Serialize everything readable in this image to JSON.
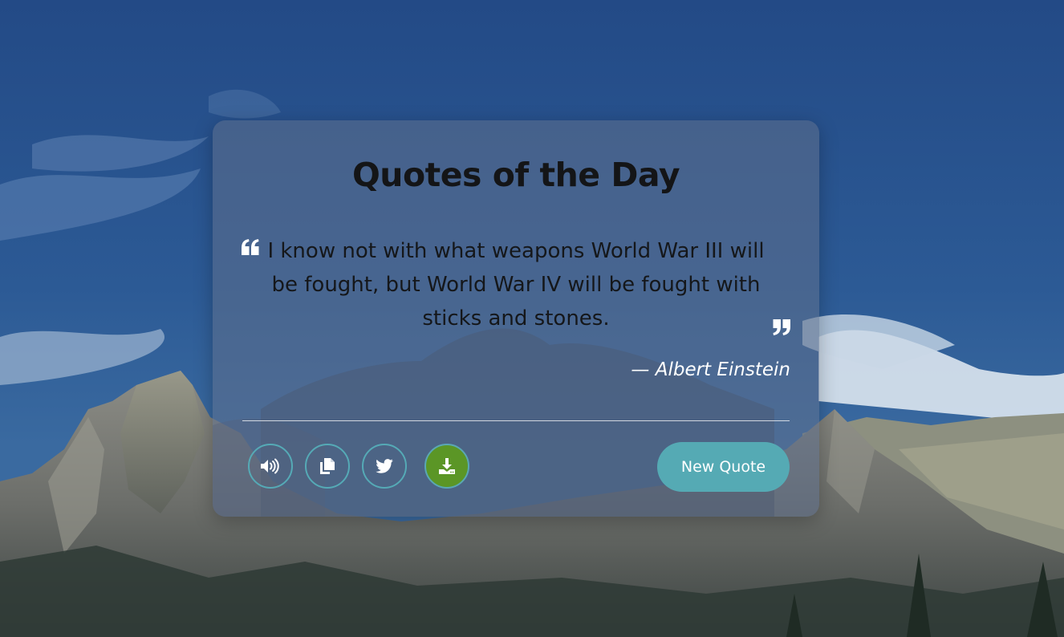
{
  "card": {
    "title": "Quotes of the Day",
    "quote": {
      "text": "I know not with what weapons World War III will be fought, but World War IV will be fought with sticks and stones.",
      "author": "— Albert Einstein",
      "open_icon": "quote-left-icon",
      "close_icon": "quote-right-icon"
    },
    "actions": {
      "speech": {
        "icon": "volume-icon"
      },
      "copy": {
        "icon": "copy-icon"
      },
      "tweet": {
        "icon": "twitter-icon"
      },
      "download": {
        "icon": "download-icon"
      },
      "new_quote_label": "New Quote"
    }
  },
  "colors": {
    "accent": "#55aab4",
    "download_button": "#5b9626",
    "title": "#141517",
    "author": "#ffffff",
    "sky": "#2b5590"
  }
}
